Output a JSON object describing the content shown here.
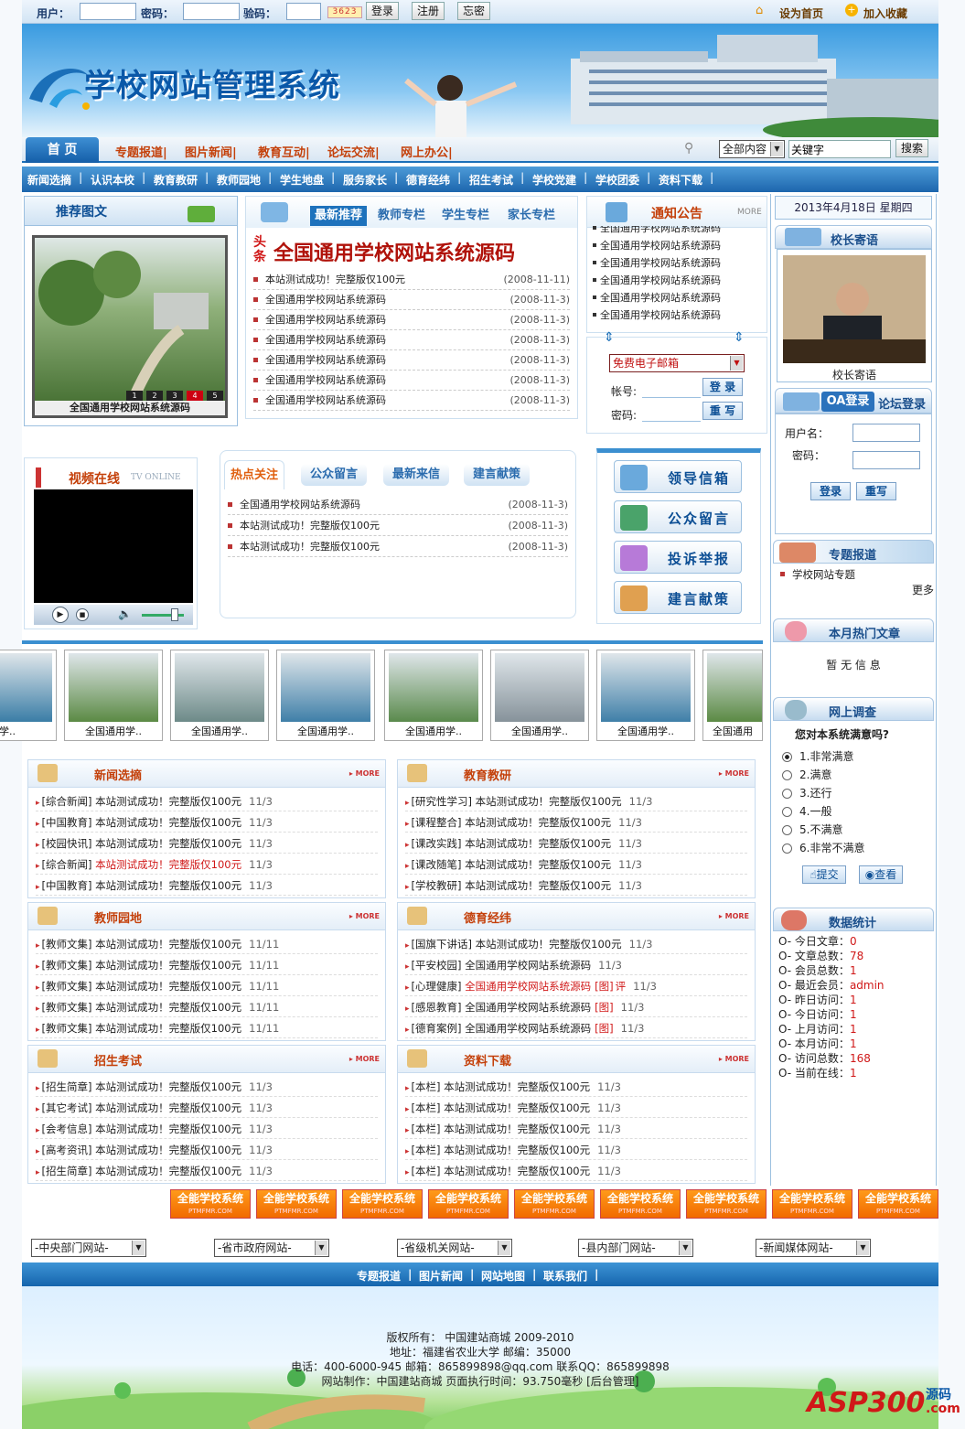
{
  "topbar": {
    "user_label": "用户：",
    "pass_label": "密码：",
    "code_label": "验码：",
    "captcha": "3623",
    "login": "登录",
    "register": "注册",
    "forgot": "忘密",
    "set_home": "设为首页",
    "add_fav": "加入收藏"
  },
  "banner": {
    "title": "学校网站管理系统"
  },
  "nav1": {
    "home": "首 页",
    "items": [
      "专题报道|",
      "图片新闻|",
      "教育互动|",
      "论坛交流|",
      "网上办公|"
    ],
    "search_scope": "全部内容",
    "search_value": "关键字",
    "search_button": "搜索"
  },
  "nav2": [
    "新闻选摘",
    "认识本校",
    "教育教研",
    "教师园地",
    "学生地盘",
    "服务家长",
    "德育经纬",
    "招生考试",
    "学校党建",
    "学校团委",
    "资料下载"
  ],
  "featured": {
    "title": "推荐图文",
    "pages": [
      "1",
      "2",
      "3",
      "4",
      "5"
    ],
    "caption": "全国通用学校网站系统源码"
  },
  "news": {
    "tabs": [
      "最新推荐",
      "教师专栏",
      "学生专栏",
      "家长专栏"
    ],
    "headline_tag": "头条",
    "headline": "全国通用学校网站系统源码",
    "items": [
      {
        "t": "本站测试成功！完整版仅100元",
        "d": "(2008-11-11)"
      },
      {
        "t": "全国通用学校网站系统源码",
        "d": "(2008-11-3)"
      },
      {
        "t": "全国通用学校网站系统源码",
        "d": "(2008-11-3)"
      },
      {
        "t": "全国通用学校网站系统源码",
        "d": "(2008-11-3)"
      },
      {
        "t": "全国通用学校网站系统源码",
        "d": "(2008-11-3)"
      },
      {
        "t": "全国通用学校网站系统源码",
        "d": "(2008-11-3)"
      },
      {
        "t": "全国通用学校网站系统源码",
        "d": "(2008-11-3)"
      }
    ]
  },
  "notice": {
    "title": "通知公告",
    "more": "MORE",
    "items": [
      "全国通用学校网站系统源码",
      "全国通用学校网站系统源码",
      "全国通用学校网站系统源码",
      "全国通用学校网站系统源码",
      "全国通用学校网站系统源码",
      "全国通用学校网站系统源码"
    ]
  },
  "mail": {
    "select": "免费电子邮箱",
    "account": "帐号:",
    "password": "密码:",
    "login": "登 录",
    "reset": "重 写"
  },
  "video": {
    "title": "视频在线",
    "sub": "TV ONLINE"
  },
  "hot": {
    "tabs": [
      "热点关注",
      "公众留言",
      "最新来信",
      "建言献策"
    ],
    "items": [
      {
        "t": "全国通用学校网站系统源码",
        "d": "(2008-11-3)"
      },
      {
        "t": "本站测试成功！完整版仅100元",
        "d": "(2008-11-3)"
      },
      {
        "t": "本站测试成功！完整版仅100元",
        "d": "(2008-11-3)"
      }
    ]
  },
  "service": [
    "领导信箱",
    "公众留言",
    "投诉举报",
    "建言献策"
  ],
  "gallery": [
    "学..",
    "全国通用学..",
    "全国通用学..",
    "全国通用学..",
    "全国通用学..",
    "全国通用学..",
    "全国通用学..",
    "全国通用"
  ],
  "sections": [
    {
      "title": "新闻选摘",
      "more": "MORE",
      "items": [
        {
          "c": "[综合新闻]",
          "t": "本站测试成功！完整版仅100元",
          "d": "11/3",
          "red": false
        },
        {
          "c": "[中国教育]",
          "t": "本站测试成功！完整版仅100元",
          "d": "11/3",
          "red": false
        },
        {
          "c": "[校园快讯]",
          "t": "本站测试成功！完整版仅100元",
          "d": "11/3",
          "red": false
        },
        {
          "c": "[综合新闻]",
          "t": "本站测试成功！完整版仅100元",
          "d": "11/3",
          "red": true
        },
        {
          "c": "[中国教育]",
          "t": "本站测试成功！完整版仅100元",
          "d": "11/3",
          "red": false
        }
      ]
    },
    {
      "title": "教育教研",
      "more": "MORE",
      "items": [
        {
          "c": "[研究性学习]",
          "t": "本站测试成功！完整版仅100元",
          "d": "11/3",
          "red": false
        },
        {
          "c": "[课程整合]",
          "t": "本站测试成功！完整版仅100元",
          "d": "11/3",
          "red": false
        },
        {
          "c": "[课改实践]",
          "t": "本站测试成功！完整版仅100元",
          "d": "11/3",
          "red": false
        },
        {
          "c": "[课改随笔]",
          "t": "本站测试成功！完整版仅100元",
          "d": "11/3",
          "red": false
        },
        {
          "c": "[学校教研]",
          "t": "本站测试成功！完整版仅100元",
          "d": "11/3",
          "red": false
        }
      ]
    },
    {
      "title": "教师园地",
      "more": "MORE",
      "items": [
        {
          "c": "[教师文集]",
          "t": "本站测试成功！完整版仅100元",
          "d": "11/11",
          "red": false
        },
        {
          "c": "[教师文集]",
          "t": "本站测试成功！完整版仅100元",
          "d": "11/11",
          "red": false
        },
        {
          "c": "[教师文集]",
          "t": "本站测试成功！完整版仅100元",
          "d": "11/11",
          "red": false
        },
        {
          "c": "[教师文集]",
          "t": "本站测试成功！完整版仅100元",
          "d": "11/11",
          "red": false
        },
        {
          "c": "[教师文集]",
          "t": "本站测试成功！完整版仅100元",
          "d": "11/11",
          "red": false
        }
      ]
    },
    {
      "title": "德育经纬",
      "more": "MORE",
      "items": [
        {
          "c": "[国旗下讲话]",
          "t": "本站测试成功！完整版仅100元",
          "d": "11/3",
          "red": false
        },
        {
          "c": "[平安校园]",
          "t": "全国通用学校网站系统源码",
          "d": "11/3",
          "red": false
        },
        {
          "c": "[心理健康]",
          "t": "全国通用学校网站系统源码",
          "tag": "[图]",
          "tag2": "评",
          "d": "11/3",
          "red": true
        },
        {
          "c": "[感恩教育]",
          "t": "全国通用学校网站系统源码",
          "tag": "[图]",
          "d": "11/3",
          "red": false
        },
        {
          "c": "[德育案例]",
          "t": "全国通用学校网站系统源码",
          "tag": "[图]",
          "d": "11/3",
          "red": false
        }
      ]
    },
    {
      "title": "招生考试",
      "more": "MORE",
      "items": [
        {
          "c": "[招生简章]",
          "t": "本站测试成功！完整版仅100元",
          "d": "11/3",
          "red": false
        },
        {
          "c": "[其它考试]",
          "t": "本站测试成功！完整版仅100元",
          "d": "11/3",
          "red": false
        },
        {
          "c": "[会考信息]",
          "t": "本站测试成功！完整版仅100元",
          "d": "11/3",
          "red": false
        },
        {
          "c": "[高考资讯]",
          "t": "本站测试成功！完整版仅100元",
          "d": "11/3",
          "red": false
        },
        {
          "c": "[招生简章]",
          "t": "本站测试成功！完整版仅100元",
          "d": "11/3",
          "red": false
        }
      ]
    },
    {
      "title": "资料下载",
      "more": "MORE",
      "items": [
        {
          "c": "[本栏]",
          "t": "本站测试成功！完整版仅100元",
          "d": "11/3",
          "red": false
        },
        {
          "c": "[本栏]",
          "t": "本站测试成功！完整版仅100元",
          "d": "11/3",
          "red": false
        },
        {
          "c": "[本栏]",
          "t": "本站测试成功！完整版仅100元",
          "d": "11/3",
          "red": false
        },
        {
          "c": "[本栏]",
          "t": "本站测试成功！完整版仅100元",
          "d": "11/3",
          "red": false
        },
        {
          "c": "[本栏]",
          "t": "本站测试成功！完整版仅100元",
          "d": "11/3",
          "red": false
        }
      ]
    }
  ],
  "sidebar": {
    "date": "2013年4月18日 星期四",
    "principal_title": "校长寄语",
    "principal_caption": "校长寄语",
    "login_tabs": [
      "OA登录",
      "论坛登录"
    ],
    "username": "用户名：",
    "password": "密码：",
    "login": "登录",
    "reset": "重写",
    "topic_title": "专题报道",
    "topic_item": "学校网站专题",
    "topic_more": "更多",
    "hot_title": "本月热门文章",
    "hot_empty": "暂 无 信 息",
    "survey_title": "网上调查",
    "survey_question": "您对本系统满意吗?",
    "survey_options": [
      "1.非常满意",
      "2.满意",
      "3.还行",
      "4.一般",
      "5.不满意",
      "6.非常不满意"
    ],
    "survey_selected": 0,
    "survey_submit": "提交",
    "survey_view": "查看",
    "stats_title": "数据统计",
    "stats": [
      {
        "k": "今日文章：",
        "v": "0"
      },
      {
        "k": "文章总数：",
        "v": "78"
      },
      {
        "k": "会员总数：",
        "v": "1"
      },
      {
        "k": "最近会员：",
        "v": "admin"
      },
      {
        "k": "昨日访问：",
        "v": "1"
      },
      {
        "k": "今日访问：",
        "v": "1"
      },
      {
        "k": "上月访问：",
        "v": "1"
      },
      {
        "k": "本月访问：",
        "v": "1"
      },
      {
        "k": "访问总数：",
        "v": "168"
      },
      {
        "k": "当前在线：",
        "v": "1"
      }
    ]
  },
  "ads": {
    "label": "全能学校系统",
    "sub": "PTMFMR.COM",
    "count": 9
  },
  "links": [
    "-中央部门网站-",
    "-省市政府网站-",
    "-省级机关网站-",
    "-县内部门网站-",
    "-新闻媒体网站-"
  ],
  "footer_nav": [
    "专题报道",
    "图片新闻",
    "网站地图",
    "联系我们"
  ],
  "footer": {
    "copyright": "版权所有： 中国建站商城 2009-2010",
    "address": "地址：福建省农业大学 邮编：35000",
    "contact": "电话：400-6000-945 邮箱：865899898@qq.com 联系QQ：865899898",
    "made": "网站制作：中国建站商城 页面执行时间：93.750毫秒 [后台管理]"
  },
  "watermark": {
    "brand": "ASP300",
    "sub": "源码",
    "dom": ".com"
  },
  "colors": {
    "primary": "#1b6fb8",
    "accent_red": "#d01818",
    "orange": "#f16a00"
  }
}
